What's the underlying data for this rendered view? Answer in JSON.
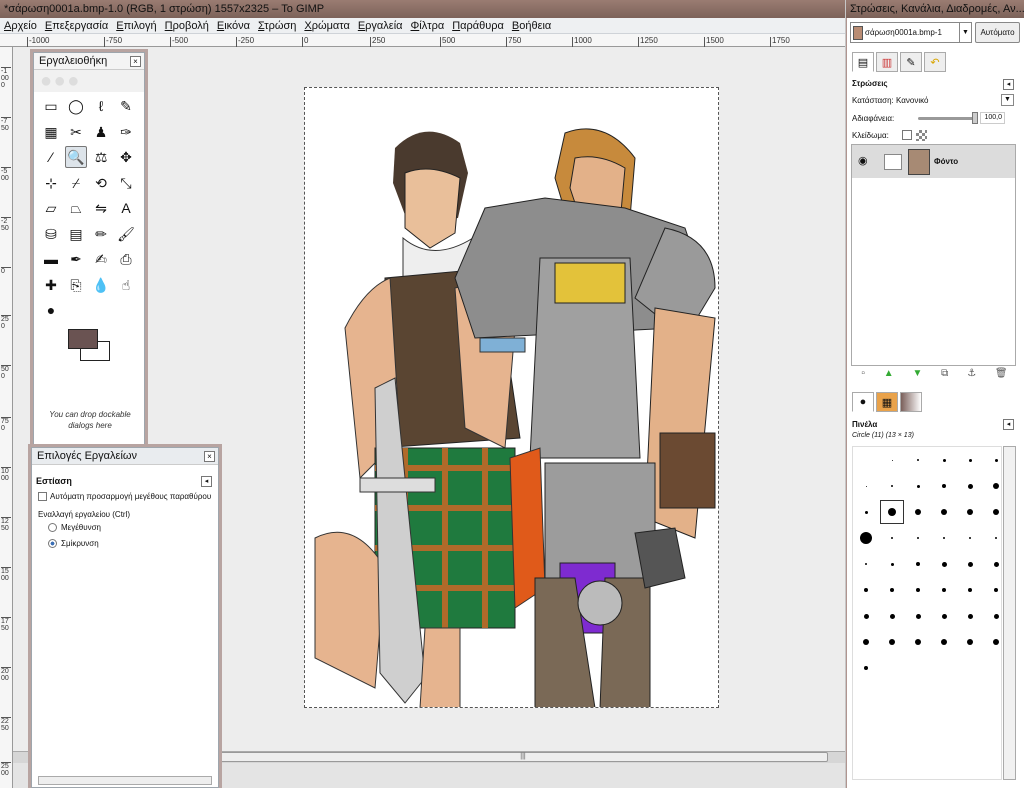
{
  "main_window": {
    "title": "*σάρωση0001a.bmp-1.0 (RGB, 1 στρώση) 1557x2325 – Το GIMP"
  },
  "menubar": [
    "Αρχείο",
    "Επεξεργασία",
    "Επιλογή",
    "Προβολή",
    "Εικόνα",
    "Στρώση",
    "Χρώματα",
    "Εργαλεία",
    "Φίλτρα",
    "Παράθυρα",
    "Βοήθεια"
  ],
  "ruler": {
    "h_ticks": [
      "-1000",
      "-750",
      "-500",
      "-250",
      "0",
      "250",
      "500",
      "750",
      "1000",
      "1250",
      "1500",
      "1750"
    ],
    "v_ticks": [
      "-1000",
      "-750",
      "-500",
      "-250",
      "0",
      "250",
      "500",
      "750",
      "1000",
      "1250",
      "1500",
      "1750",
      "2000",
      "2250",
      "2500"
    ]
  },
  "toolbox": {
    "title": "Εργαλειοθήκη",
    "close": "×",
    "drop_hint": "You can drop dockable dialogs here",
    "colors": {
      "foreground": "#6a5352",
      "background": "#ffffff"
    },
    "tools": [
      {
        "name": "rect-select-icon",
        "glyph": "▭"
      },
      {
        "name": "ellipse-select-icon",
        "glyph": "◯"
      },
      {
        "name": "free-select-icon",
        "glyph": "ℓ"
      },
      {
        "name": "fuzzy-select-icon",
        "glyph": "✎"
      },
      {
        "name": "color-select-icon",
        "glyph": "▦"
      },
      {
        "name": "scissors-icon",
        "glyph": "✂"
      },
      {
        "name": "foreground-select-icon",
        "glyph": "♟"
      },
      {
        "name": "paths-icon",
        "glyph": "✑"
      },
      {
        "name": "color-picker-icon",
        "glyph": "⁄"
      },
      {
        "name": "zoom-icon",
        "glyph": "🔍"
      },
      {
        "name": "measure-icon",
        "glyph": "⚖"
      },
      {
        "name": "move-icon",
        "glyph": "✥"
      },
      {
        "name": "align-icon",
        "glyph": "⊹"
      },
      {
        "name": "crop-icon",
        "glyph": "⌿"
      },
      {
        "name": "rotate-icon",
        "glyph": "⟲"
      },
      {
        "name": "scale-icon",
        "glyph": "⤡"
      },
      {
        "name": "shear-icon",
        "glyph": "▱"
      },
      {
        "name": "perspective-icon",
        "glyph": "⏢"
      },
      {
        "name": "flip-icon",
        "glyph": "⇋"
      },
      {
        "name": "text-icon",
        "glyph": "A"
      },
      {
        "name": "bucket-fill-icon",
        "glyph": "⛁"
      },
      {
        "name": "blend-icon",
        "glyph": "▤"
      },
      {
        "name": "pencil-icon",
        "glyph": "✏"
      },
      {
        "name": "paintbrush-icon",
        "glyph": "🖌"
      },
      {
        "name": "eraser-icon",
        "glyph": "▬"
      },
      {
        "name": "airbrush-icon",
        "glyph": "✒"
      },
      {
        "name": "ink-icon",
        "glyph": "✍"
      },
      {
        "name": "clone-icon",
        "glyph": "⎙"
      },
      {
        "name": "heal-icon",
        "glyph": "✚"
      },
      {
        "name": "perspective-clone-icon",
        "glyph": "⎘"
      },
      {
        "name": "blur-icon",
        "glyph": "💧"
      },
      {
        "name": "smudge-icon",
        "glyph": "☝"
      },
      {
        "name": "dodge-burn-icon",
        "glyph": "●"
      }
    ]
  },
  "tool_options": {
    "title": "Επιλογές Εργαλείων",
    "close": "×",
    "section": "Εστίαση",
    "auto_resize": "Αυτόματη προσαρμογή μεγέθους παραθύρου",
    "toggle_label": "Εναλλαγή εργαλείου  (Ctrl)",
    "radio_in": "Μεγέθυνση",
    "radio_out": "Σμίκρυνση"
  },
  "right_dock": {
    "title": "Στρώσεις, Κανάλια, Διαδρομές, Αν...",
    "image_select": "σάρωση0001a.bmp-1",
    "auto_button": "Αυτόματο",
    "layers": {
      "heading": "Στρώσεις",
      "mode_label": "Κατάσταση:",
      "mode_value": "Κανονικό",
      "opacity_label": "Αδιαφάνεια:",
      "opacity_value": "100,0",
      "lock_label": "Κλείδωμα:",
      "layer_name": "Φόντο"
    },
    "brushes": {
      "heading": "Πινέλα",
      "selected": "Circle (11) (13 × 13)"
    }
  },
  "hscroll_mark": "|||"
}
